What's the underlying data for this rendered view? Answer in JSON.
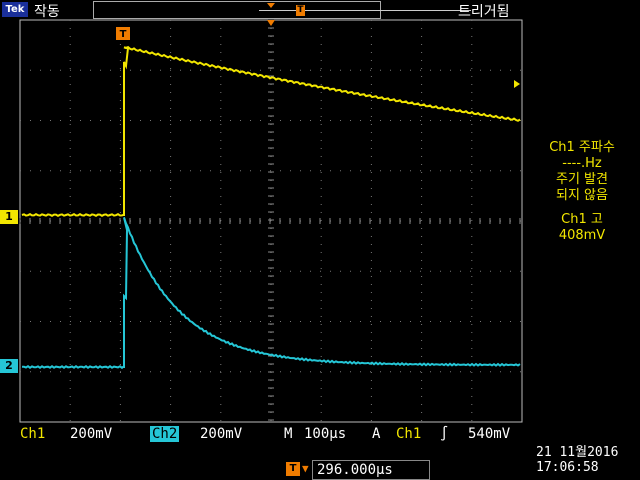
{
  "header": {
    "logo": "Tek",
    "status": "작동",
    "trigger_mode": "트리거됨"
  },
  "markers": {
    "ch1": "1",
    "ch2": "2",
    "trigger": "T"
  },
  "side_panel": {
    "line1": "Ch1 주파수",
    "line2": "----.Hz",
    "line3": "주기 발견",
    "line4": "되지 않음",
    "line5": "Ch1 고",
    "line6": "408mV"
  },
  "bottom": {
    "ch1_label": "Ch1",
    "ch1_scale": "200mV",
    "ch2_label": "Ch2",
    "ch2_scale": "200mV",
    "m_label": "M",
    "timebase": "100µs",
    "a_label": "A",
    "trigger_source": "Ch1",
    "slope": "∫",
    "trigger_level": "540mV"
  },
  "trigger_position": "296.000µs",
  "date": "21 11월2016",
  "time": "17:06:58",
  "colors": {
    "ch1": "#f2e600",
    "ch2": "#25c6d6",
    "trigger": "#f07c00"
  }
}
